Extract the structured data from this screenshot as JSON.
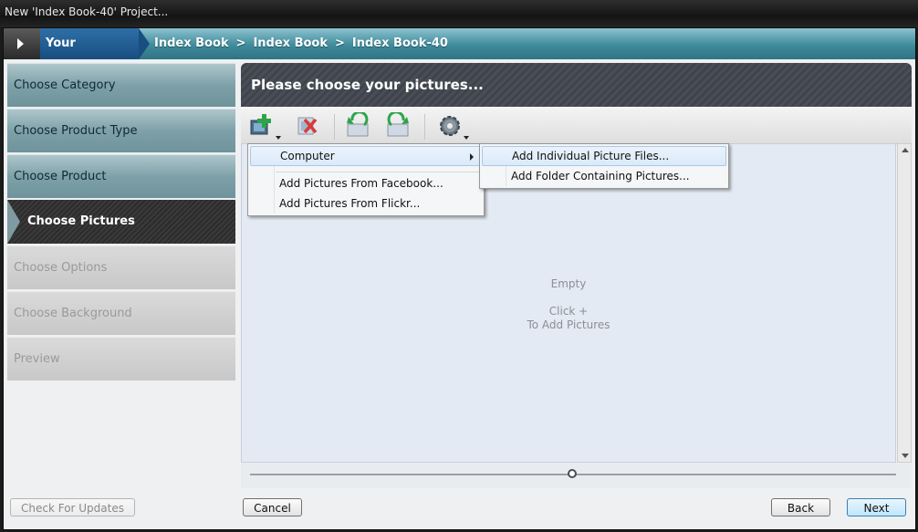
{
  "window": {
    "title": "New 'Index Book-40' Project..."
  },
  "selections": {
    "label": "Your Selections:",
    "crumbs": [
      "Index Book",
      "Index Book",
      "Index Book-40"
    ],
    "separator": ">"
  },
  "steps": [
    {
      "label": "Choose Category",
      "state": "done"
    },
    {
      "label": "Choose Product Type",
      "state": "done"
    },
    {
      "label": "Choose Product",
      "state": "done"
    },
    {
      "label": "Choose Pictures",
      "state": "active"
    },
    {
      "label": "Choose Options",
      "state": "todo"
    },
    {
      "label": "Choose Background",
      "state": "todo"
    },
    {
      "label": "Preview",
      "state": "todo"
    }
  ],
  "main": {
    "heading": "Please choose your pictures...",
    "toolbar": [
      {
        "name": "add-pictures-icon",
        "dropdown": true
      },
      {
        "name": "remove-pictures-icon",
        "dropdown": false
      },
      {
        "name": "rotate-left-icon",
        "dropdown": false
      },
      {
        "name": "rotate-right-icon",
        "dropdown": false
      },
      {
        "name": "settings-gear-icon",
        "dropdown": true
      }
    ],
    "empty_title": "Empty",
    "empty_hint_1": "Click +",
    "empty_hint_2": "To Add Pictures"
  },
  "add_menu": {
    "items": [
      "Computer",
      "Add Pictures From Facebook...",
      "Add Pictures From Flickr..."
    ],
    "submenu": [
      "Add Individual Picture Files...",
      "Add Folder Containing Pictures..."
    ]
  },
  "footer": {
    "check_updates": "Check For Updates",
    "cancel": "Cancel",
    "back": "Back",
    "next": "Next"
  },
  "colors": {
    "accent": "#2f7484",
    "selection_blue": "#184e80",
    "heading_dark": "#3f444c"
  }
}
